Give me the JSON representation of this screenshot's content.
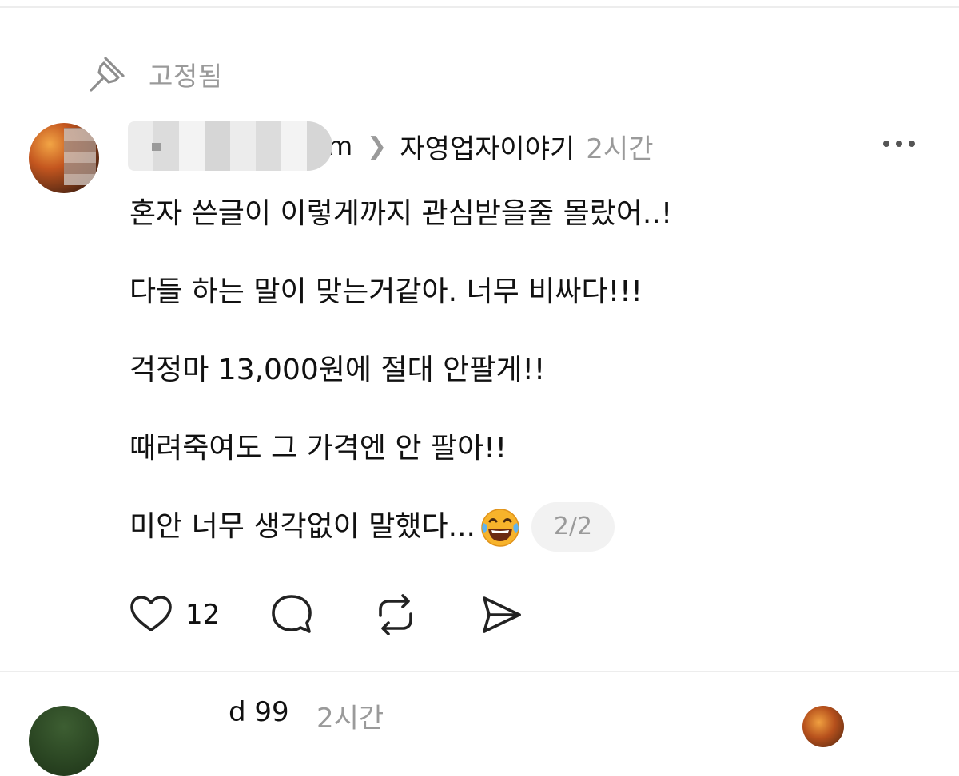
{
  "pinned": {
    "label": "고정됨",
    "icon": "pin-icon"
  },
  "post": {
    "username_visible_suffix": "m",
    "topic": "자영업자이야기",
    "time": "2시간",
    "lines": [
      "혼자 쓴글이 이렇게까지 관심받을줄 몰랐어..!",
      "다들 하는 말이 맞는거같아. 너무 비싸다!!!",
      "걱정마 13,000원에 절대 안팔게!!",
      "때려죽여도 그 가격엔 안 팔아!!",
      "미안 너무 생각없이 말했다..."
    ],
    "emoji": "😂",
    "page_indicator": "2/2",
    "likes": "12"
  },
  "next_post": {
    "snippet": "d 99",
    "time": "2시간"
  },
  "colors": {
    "text_primary": "#111111",
    "text_secondary": "#9a9a9a",
    "badge_bg": "#f2f2f2",
    "divider": "#ededed"
  }
}
